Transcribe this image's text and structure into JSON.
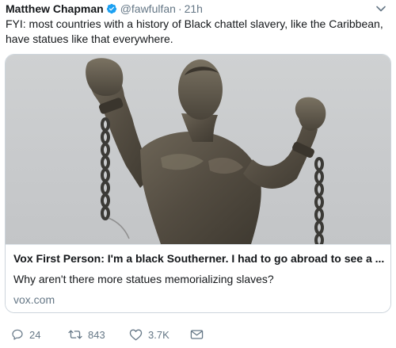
{
  "tweet": {
    "author": {
      "name": "Matthew Chapman",
      "handle": "@fawfulfan",
      "verified": true
    },
    "separator": "·",
    "time": "21h",
    "text": "FYI: most countries with a history of Black chattel slavery, like the Caribbean, have statues like that everywhere.",
    "card": {
      "title": "Vox First Person: I'm a black Southerner. I had to go abroad to see a ...",
      "description": "Why aren't there more statues memorializing slaves?",
      "domain": "vox.com"
    },
    "actions": {
      "replies": "24",
      "retweets": "843",
      "likes": "3.7K"
    }
  },
  "colors": {
    "text": "#14171a",
    "secondary": "#657786",
    "verified": "#1da1f2",
    "border": "#cdd5dc"
  },
  "icons": [
    "verified-badge-icon",
    "chevron-down-icon",
    "reply-icon",
    "retweet-icon",
    "like-icon",
    "direct-message-icon"
  ]
}
